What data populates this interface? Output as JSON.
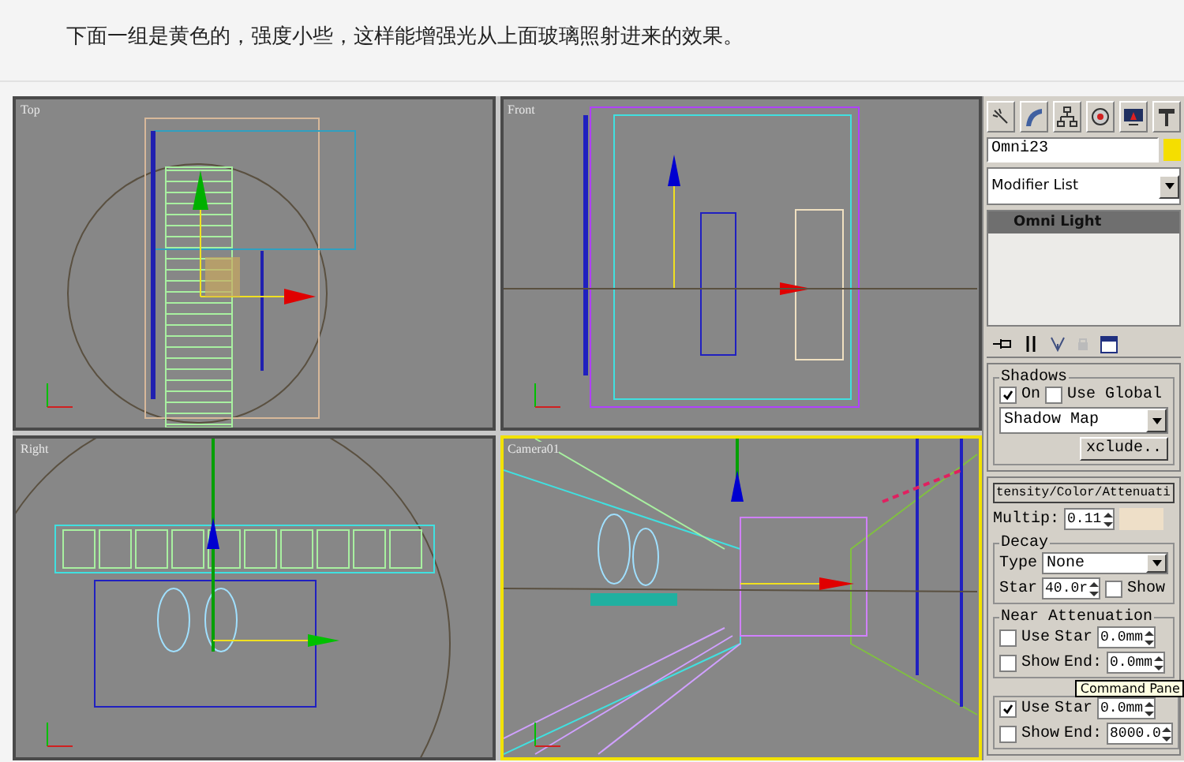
{
  "caption": "下面一组是黄色的，强度小些，这样能增强光从上面玻璃照射进来的效果。",
  "viewports": [
    {
      "label": "Top",
      "active": false
    },
    {
      "label": "Front",
      "active": false
    },
    {
      "label": "Right",
      "active": false
    },
    {
      "label": "Camera01",
      "active": true
    }
  ],
  "command_panel": {
    "object_name": "Omni23",
    "modifier_list": "Modifier List",
    "stack": [
      {
        "label": "Omni Light",
        "selected": true
      }
    ],
    "shadows": {
      "title": "Shadows",
      "on": {
        "label": "On",
        "checked": true
      },
      "use_global": {
        "label": "Use Global",
        "checked": false
      },
      "type": "Shadow Map",
      "exclude": "xclude.."
    },
    "intensity": {
      "title": "tensity/Color/Attenuati",
      "multiplier_label": "Multip:",
      "multiplier": "0.11",
      "decay": {
        "title": "Decay",
        "type_label": "Type",
        "type": "None",
        "start_label": "Star",
        "start": "40.0r",
        "show": {
          "label": "Show",
          "checked": false
        }
      },
      "near": {
        "title": "Near Attenuation",
        "use": {
          "label": "Use",
          "checked": false
        },
        "show": {
          "label": "Show",
          "checked": false
        },
        "start_label": "Star",
        "start": "0.0mm",
        "end_label": "End:",
        "end": "0.0mm"
      },
      "far": {
        "use": {
          "label": "Use",
          "checked": true
        },
        "show": {
          "label": "Show",
          "checked": false
        },
        "start_label": "Star",
        "start": "0.0mm",
        "end_label": "End:",
        "end": "8000.0"
      }
    }
  },
  "tooltip": "Command Pane"
}
